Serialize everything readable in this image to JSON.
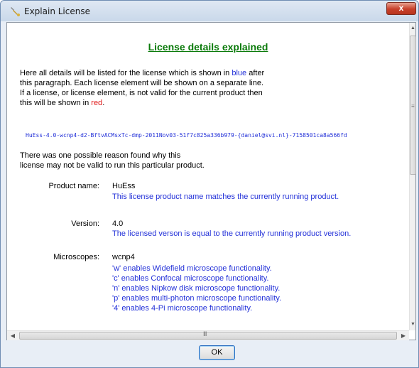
{
  "window": {
    "title": "Explain License",
    "close_label": "x"
  },
  "heading": "License details explained",
  "intro": {
    "line1_pre": "Here all details will be listed for the license which is shown in ",
    "line1_blue": "blue",
    "line1_post": " after",
    "line2": "this paragraph.  Each license element will be shown on a separate line.",
    "line3": "If a license, or license element, is not valid for the current product then",
    "line4_pre": "this will be shown in ",
    "line4_red": "red",
    "line4_post": "."
  },
  "license_code": "HuEss-4.0-wcnp4-d2-BftvACMsxTc-dmp-2011Nov03-51f7c825a336b979-{daniel@svi.nl}-7158501ca8a566fd",
  "reason": {
    "line1": "There was one possible reason found why this",
    "line2": "license may not be valid to run this particular product."
  },
  "details": {
    "product": {
      "label": "Product name:",
      "value": "HuEss",
      "desc": "This license product name matches the currently running product."
    },
    "version": {
      "label": "Version:",
      "value": "4.0",
      "desc": "The licensed verson is equal to the currently running product version."
    },
    "microscopes": {
      "label": "Microscopes:",
      "value": "wcnp4",
      "features": [
        "'w' enables Widefield microscope functionality.",
        "'c' enables Confocal microscope functionality.",
        "'n' enables Nipkow disk microscope functionality.",
        "'p' enables multi-photon microscope functionality.",
        "'4' enables 4-Pi microscope functionality."
      ]
    }
  },
  "scrollbars": {
    "h_grip": "III",
    "v_grip": "≡"
  },
  "ok_label": "OK",
  "colors": {
    "heading": "#0a7a0a",
    "valid_text": "#2230d8",
    "invalid_text": "#e01818"
  }
}
